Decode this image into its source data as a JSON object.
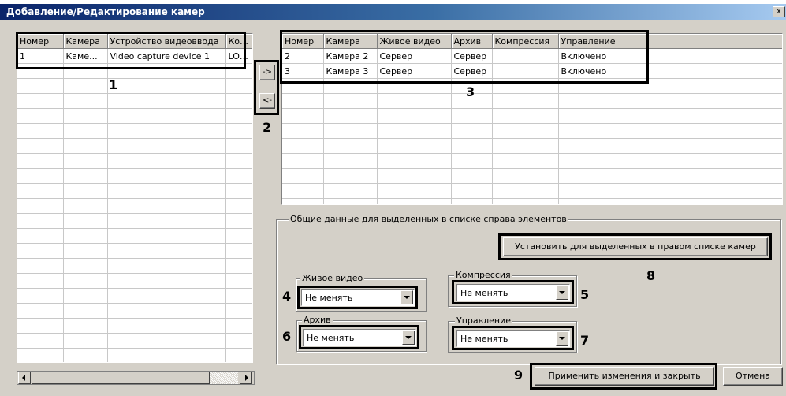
{
  "window": {
    "title": "Добавление/Редактирование камер",
    "close_glyph": "x"
  },
  "left_table": {
    "columns": [
      "Номер",
      "Камера",
      "Устройство видеоввода",
      "Компр"
    ],
    "rows": [
      [
        "1",
        "Каме...",
        "Video capture device 1",
        "LOCA"
      ]
    ]
  },
  "right_table": {
    "columns": [
      "Номер",
      "Камера",
      "Живое видео",
      "Архив",
      "Компрессия",
      "Управление"
    ],
    "rows": [
      [
        "2",
        "Камера 2",
        "Сервер",
        "Сервер",
        "",
        "Включено"
      ],
      [
        "3",
        "Камера 3",
        "Сервер",
        "Сервер",
        "",
        "Включено"
      ]
    ]
  },
  "transfer": {
    "add_label": "->",
    "remove_label": "<-"
  },
  "common_group": {
    "legend": "Общие данные для выделенных в списке справа элементов",
    "set_button": "Установить для выделенных в правом списке камер",
    "live_video": {
      "legend": "Живое видео",
      "value": "Не менять"
    },
    "compression": {
      "legend": "Компрессия",
      "value": "Не менять"
    },
    "archive": {
      "legend": "Архив",
      "value": "Не менять"
    },
    "control": {
      "legend": "Управление",
      "value": "Не менять"
    }
  },
  "footer": {
    "apply_button": "Применить изменения и закрыть",
    "cancel_button": "Отмена"
  },
  "callouts": [
    "1",
    "2",
    "3",
    "4",
    "5",
    "6",
    "7",
    "8",
    "9"
  ],
  "icons": {
    "close": "close-icon",
    "scroll_left": "arrow-left-icon",
    "scroll_right": "arrow-right-icon",
    "dropdown": "chevron-down-icon"
  },
  "colors": {
    "title_bar": "#0a246a",
    "window_bg": "#d4d0c8",
    "highlight_frame": "#000000"
  }
}
